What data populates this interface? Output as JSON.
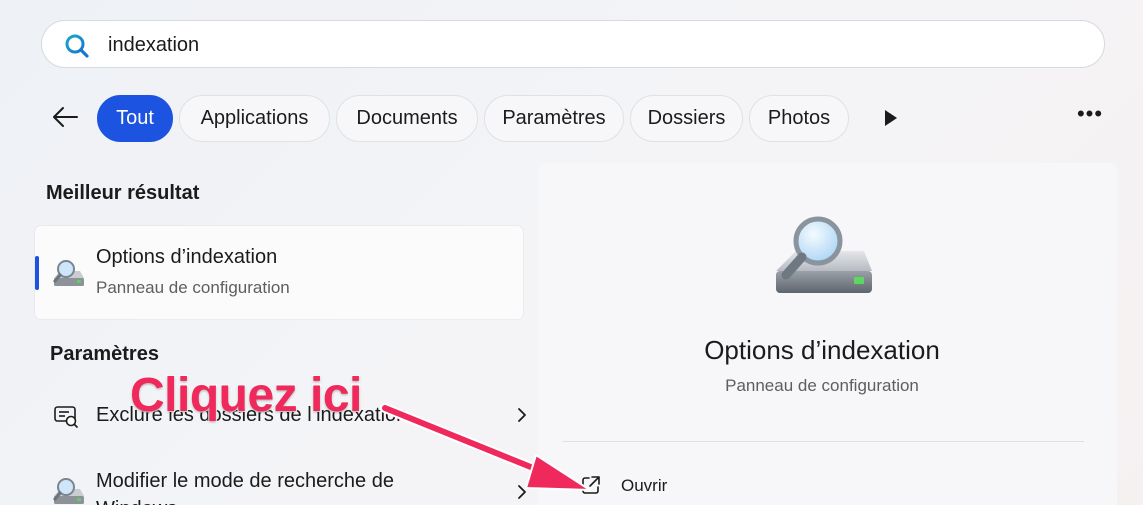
{
  "search": {
    "value": "indexation",
    "icon": "search-icon"
  },
  "filters": {
    "back_icon": "arrow-left-icon",
    "chips": [
      "Tout",
      "Applications",
      "Documents",
      "Paramètres",
      "Dossiers",
      "Photos"
    ],
    "active": "Tout",
    "play_icon": "play-icon",
    "more_label": "•••"
  },
  "best_result": {
    "section_title": "Meilleur résultat",
    "title": "Options d’indexation",
    "subtitle": "Panneau de configuration",
    "icon": "indexing-options-icon"
  },
  "settings": {
    "section_title": "Paramètres",
    "items": [
      {
        "label": "Exclure les dossiers de l’indexation",
        "icon": "exclude-folders-icon"
      },
      {
        "label": "Modifier le mode de recherche de Windows",
        "icon": "indexing-options-icon"
      }
    ]
  },
  "detail": {
    "title": "Options d’indexation",
    "subtitle": "Panneau de configuration",
    "icon": "indexing-options-icon",
    "actions": [
      {
        "label": "Ouvrir",
        "icon": "open-external-icon"
      }
    ]
  },
  "annotation": {
    "text": "Cliquez ici",
    "color": "#f0295c"
  },
  "colors": {
    "accent": "#1c53e0",
    "annotation": "#f0295c"
  }
}
